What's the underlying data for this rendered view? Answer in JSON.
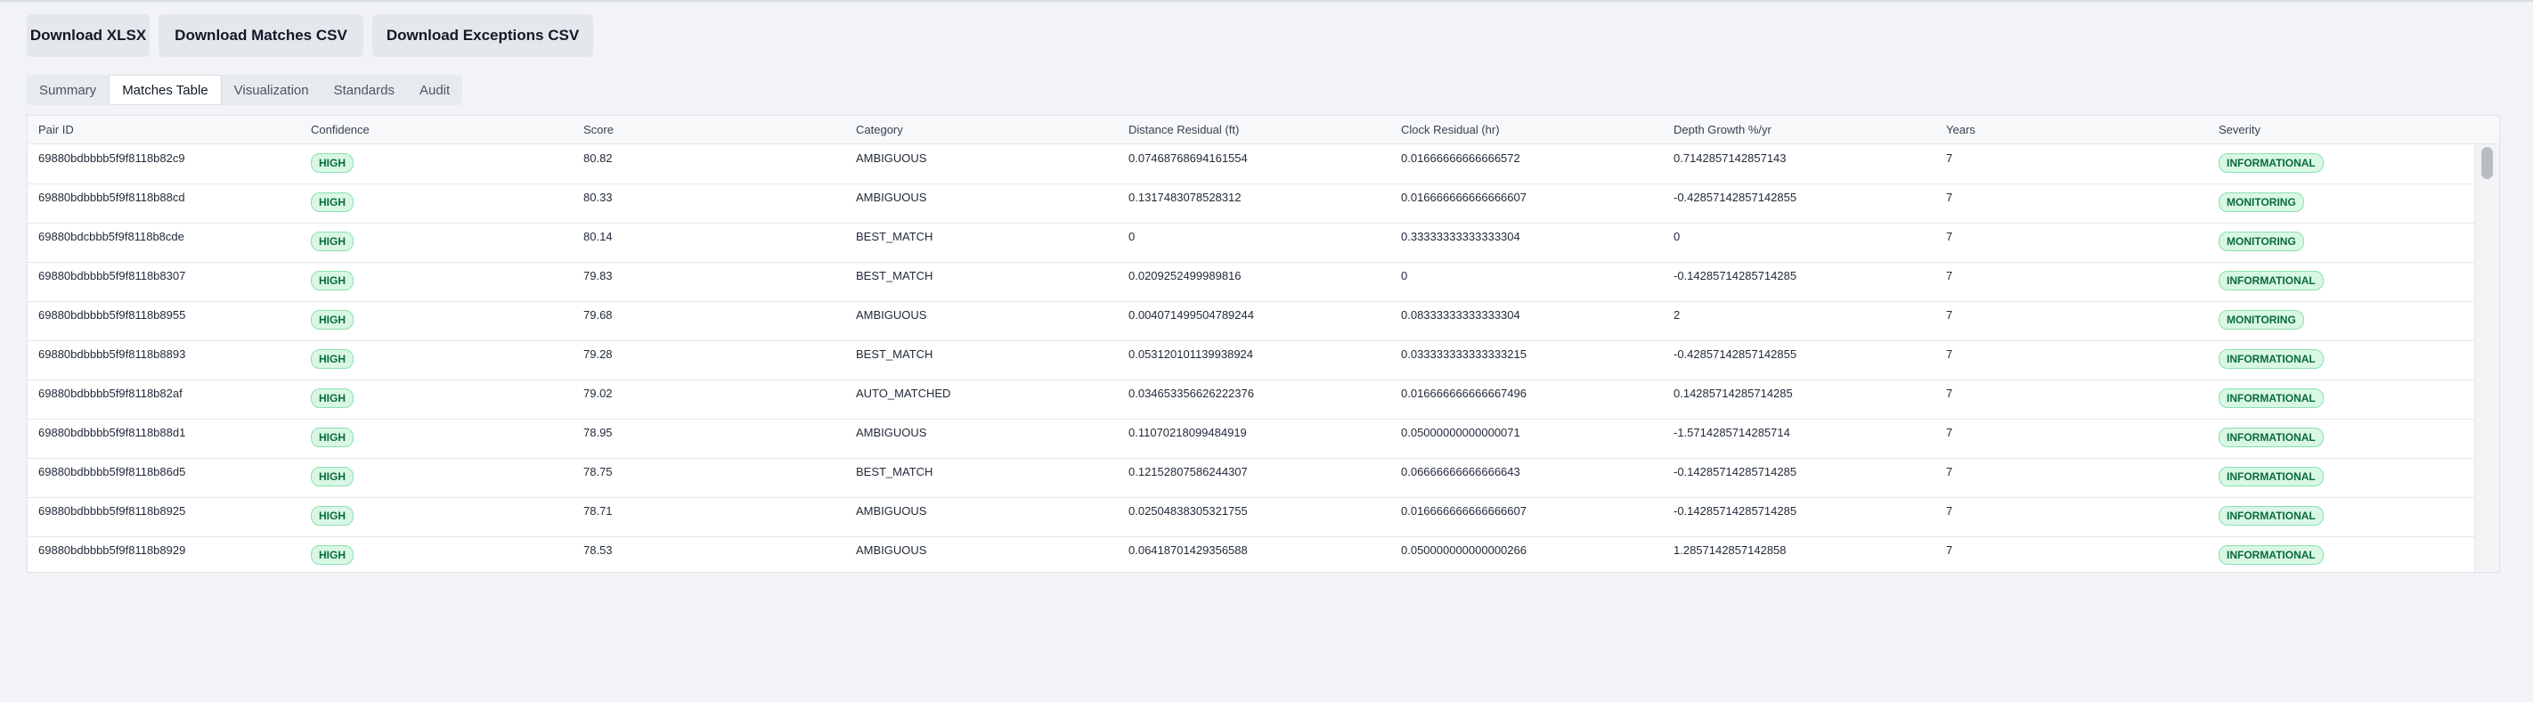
{
  "downloads": {
    "xlsx_label": "Download XLSX",
    "matches_csv_label": "Download Matches CSV",
    "exceptions_csv_label": "Download Exceptions CSV"
  },
  "tabs": [
    {
      "label": "Summary"
    },
    {
      "label": "Matches Table",
      "active": true
    },
    {
      "label": "Visualization"
    },
    {
      "label": "Standards"
    },
    {
      "label": "Audit"
    }
  ],
  "table": {
    "columns": [
      "Pair ID",
      "Confidence",
      "Score",
      "Category",
      "Distance Residual (ft)",
      "Clock Residual (hr)",
      "Depth Growth %/yr",
      "Years",
      "Severity"
    ],
    "rows": [
      {
        "pair_id": "69880bdbbbb5f9f8118b82c9",
        "confidence": "HIGH",
        "score": "80.82",
        "category": "AMBIGUOUS",
        "distance": "0.07468768694161554",
        "clock": "0.01666666666666572",
        "depth": "0.7142857142857143",
        "years": "7",
        "severity": "INFORMATIONAL"
      },
      {
        "pair_id": "69880bdbbbb5f9f8118b88cd",
        "confidence": "HIGH",
        "score": "80.33",
        "category": "AMBIGUOUS",
        "distance": "0.1317483078528312",
        "clock": "0.016666666666666607",
        "depth": "-0.42857142857142855",
        "years": "7",
        "severity": "MONITORING"
      },
      {
        "pair_id": "69880bdcbbb5f9f8118b8cde",
        "confidence": "HIGH",
        "score": "80.14",
        "category": "BEST_MATCH",
        "distance": "0",
        "clock": "0.33333333333333304",
        "depth": "0",
        "years": "7",
        "severity": "MONITORING"
      },
      {
        "pair_id": "69880bdbbbb5f9f8118b8307",
        "confidence": "HIGH",
        "score": "79.83",
        "category": "BEST_MATCH",
        "distance": "0.0209252499989816",
        "clock": "0",
        "depth": "-0.14285714285714285",
        "years": "7",
        "severity": "INFORMATIONAL"
      },
      {
        "pair_id": "69880bdbbbb5f9f8118b8955",
        "confidence": "HIGH",
        "score": "79.68",
        "category": "AMBIGUOUS",
        "distance": "0.004071499504789244",
        "clock": "0.08333333333333304",
        "depth": "2",
        "years": "7",
        "severity": "MONITORING"
      },
      {
        "pair_id": "69880bdbbbb5f9f8118b8893",
        "confidence": "HIGH",
        "score": "79.28",
        "category": "BEST_MATCH",
        "distance": "0.053120101139938924",
        "clock": "0.033333333333333215",
        "depth": "-0.42857142857142855",
        "years": "7",
        "severity": "INFORMATIONAL"
      },
      {
        "pair_id": "69880bdbbbb5f9f8118b82af",
        "confidence": "HIGH",
        "score": "79.02",
        "category": "AUTO_MATCHED",
        "distance": "0.034653356626222376",
        "clock": "0.016666666666667496",
        "depth": "0.14285714285714285",
        "years": "7",
        "severity": "INFORMATIONAL"
      },
      {
        "pair_id": "69880bdbbbb5f9f8118b88d1",
        "confidence": "HIGH",
        "score": "78.95",
        "category": "AMBIGUOUS",
        "distance": "0.11070218099484919",
        "clock": "0.05000000000000071",
        "depth": "-1.5714285714285714",
        "years": "7",
        "severity": "INFORMATIONAL"
      },
      {
        "pair_id": "69880bdbbbb5f9f8118b86d5",
        "confidence": "HIGH",
        "score": "78.75",
        "category": "BEST_MATCH",
        "distance": "0.12152807586244307",
        "clock": "0.06666666666666643",
        "depth": "-0.14285714285714285",
        "years": "7",
        "severity": "INFORMATIONAL"
      },
      {
        "pair_id": "69880bdbbbb5f9f8118b8925",
        "confidence": "HIGH",
        "score": "78.71",
        "category": "AMBIGUOUS",
        "distance": "0.02504838305321755",
        "clock": "0.016666666666666607",
        "depth": "-0.14285714285714285",
        "years": "7",
        "severity": "INFORMATIONAL"
      },
      {
        "pair_id": "69880bdbbbb5f9f8118b8929",
        "confidence": "HIGH",
        "score": "78.53",
        "category": "AMBIGUOUS",
        "distance": "0.06418701429356588",
        "clock": "0.050000000000000266",
        "depth": "1.2857142857142858",
        "years": "7",
        "severity": "INFORMATIONAL"
      }
    ]
  }
}
